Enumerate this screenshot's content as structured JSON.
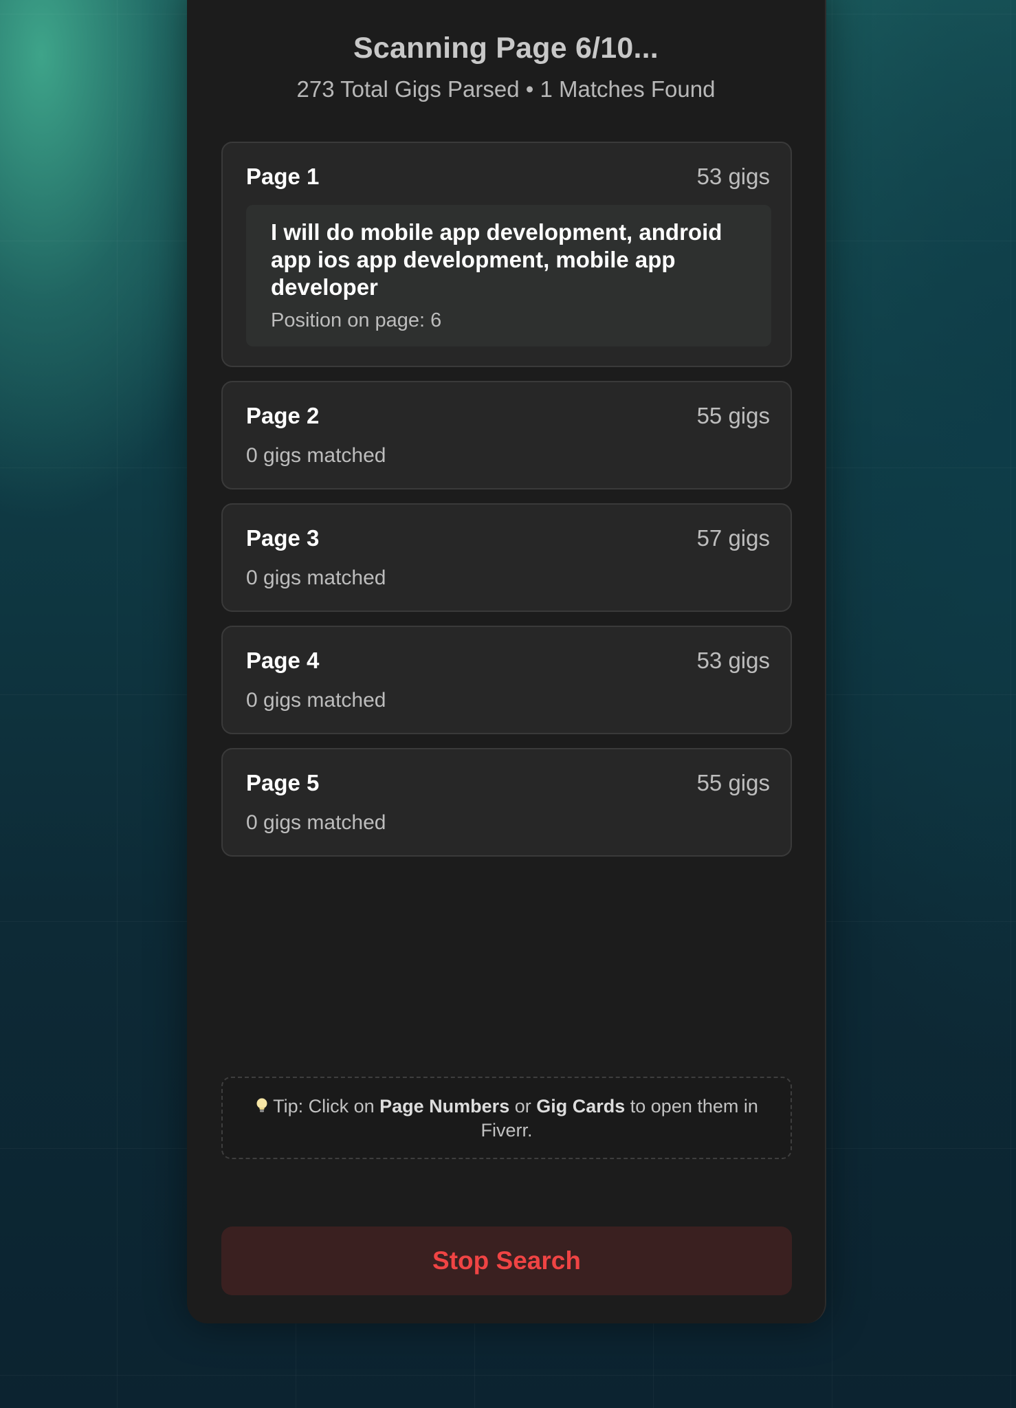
{
  "header": {
    "title": "Scanning Page 6/10...",
    "subtitle": "273 Total Gigs Parsed • 1 Matches Found"
  },
  "pages": [
    {
      "label": "Page 1",
      "gigs": "53 gigs",
      "match": {
        "title": "I will do mobile app development, android app ios app development, mobile app developer",
        "position": "Position on page: 6"
      }
    },
    {
      "label": "Page 2",
      "gigs": "55 gigs",
      "matched": "0 gigs matched"
    },
    {
      "label": "Page 3",
      "gigs": "57 gigs",
      "matched": "0 gigs matched"
    },
    {
      "label": "Page 4",
      "gigs": "53 gigs",
      "matched": "0 gigs matched"
    },
    {
      "label": "Page 5",
      "gigs": "55 gigs",
      "matched": "0 gigs matched"
    }
  ],
  "tip": {
    "icon": "lightbulb-icon",
    "prefix": "Tip: Click on ",
    "page_numbers": "Page Numbers",
    "or": " or ",
    "gig_cards": "Gig Cards",
    "suffix": " to open them in Fiverr."
  },
  "actions": {
    "stop_label": "Stop Search"
  },
  "colors": {
    "panel_bg": "#1c1c1c",
    "card_bg": "#272727",
    "stop_text": "#f04444",
    "stop_bg": "#3a2020"
  }
}
